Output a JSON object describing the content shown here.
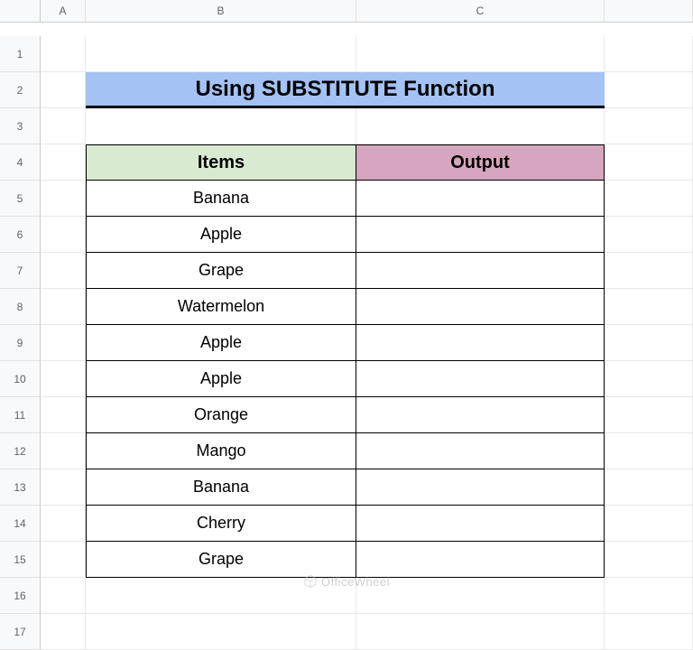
{
  "columns": [
    "A",
    "B",
    "C"
  ],
  "row_count": 17,
  "title": "Using SUBSTITUTE Function",
  "headers": {
    "items": "Items",
    "output": "Output"
  },
  "items": [
    "Banana",
    "Apple",
    "Grape",
    "Watermelon",
    "Apple",
    "Apple",
    "Orange",
    "Mango",
    "Banana",
    "Cherry",
    "Grape"
  ],
  "outputs": [
    "",
    "",
    "",
    "",
    "",
    "",
    "",
    "",
    "",
    "",
    ""
  ],
  "watermark": "OfficeWheel",
  "chart_data": {
    "type": "table",
    "title": "Using SUBSTITUTE Function",
    "columns": [
      "Items",
      "Output"
    ],
    "rows": [
      [
        "Banana",
        ""
      ],
      [
        "Apple",
        ""
      ],
      [
        "Grape",
        ""
      ],
      [
        "Watermelon",
        ""
      ],
      [
        "Apple",
        ""
      ],
      [
        "Apple",
        ""
      ],
      [
        "Orange",
        ""
      ],
      [
        "Mango",
        ""
      ],
      [
        "Banana",
        ""
      ],
      [
        "Cherry",
        ""
      ],
      [
        "Grape",
        ""
      ]
    ]
  }
}
